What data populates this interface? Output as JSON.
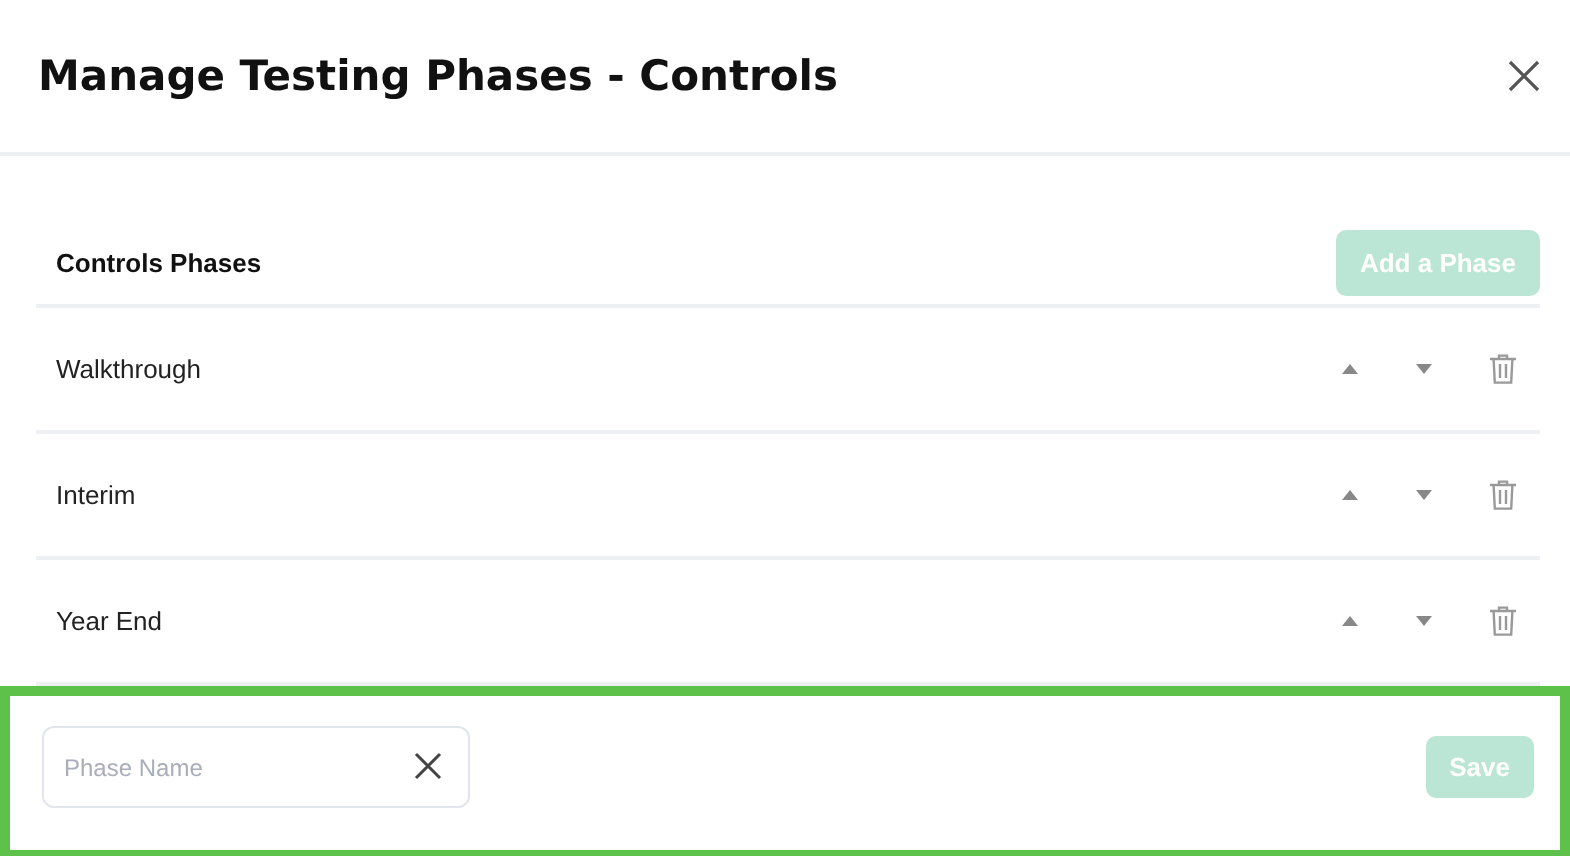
{
  "dialog": {
    "title": "Manage Testing Phases - Controls"
  },
  "section": {
    "heading": "Controls Phases",
    "add_button": {
      "label": "Add a Phase",
      "disabled": true
    }
  },
  "phases": [
    {
      "name": "Walkthrough"
    },
    {
      "name": "Interim"
    },
    {
      "name": "Year End"
    }
  ],
  "new_phase": {
    "placeholder": "Phase Name",
    "save_button": {
      "label": "Save",
      "disabled": true
    }
  }
}
